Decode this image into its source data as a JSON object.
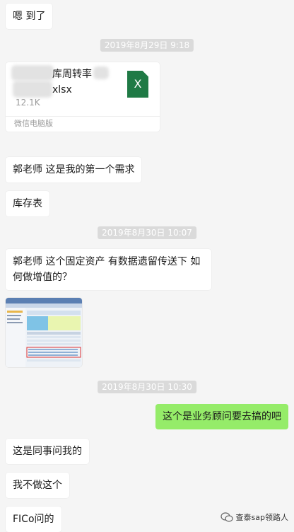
{
  "messages": [
    {
      "text": "嗯 到了"
    },
    {
      "timestamp": "2019年8月29日 9:18"
    },
    {
      "file": {
        "name_part1": "库周转率",
        "name_part2": "xlsx",
        "size": "12.1K",
        "source": "微信电脑版",
        "icon_label": "X",
        "icon_color": "#1f7a45"
      }
    },
    {
      "text": "郭老师 这是我的第一个需求"
    },
    {
      "text": "库存表"
    },
    {
      "timestamp": "2019年8月30日 10:07"
    },
    {
      "text_line1": "郭老师 这个固定资产  有数据遗留传送下  如",
      "text_line2": "何做增值的？"
    },
    {
      "image": "sap-screenshot-thumbnail"
    },
    {
      "timestamp": "2019年8月30日 10:30"
    },
    {
      "text": "这个是业务顾问要去搞的吧",
      "side": "right",
      "color": "#95ec69"
    },
    {
      "text": "这是同事问我的"
    },
    {
      "text": "我不做这个"
    },
    {
      "text": "FICo问的"
    }
  ],
  "watermark": {
    "text": "查泰sap领路人",
    "icon": "wechat-official-icon"
  }
}
